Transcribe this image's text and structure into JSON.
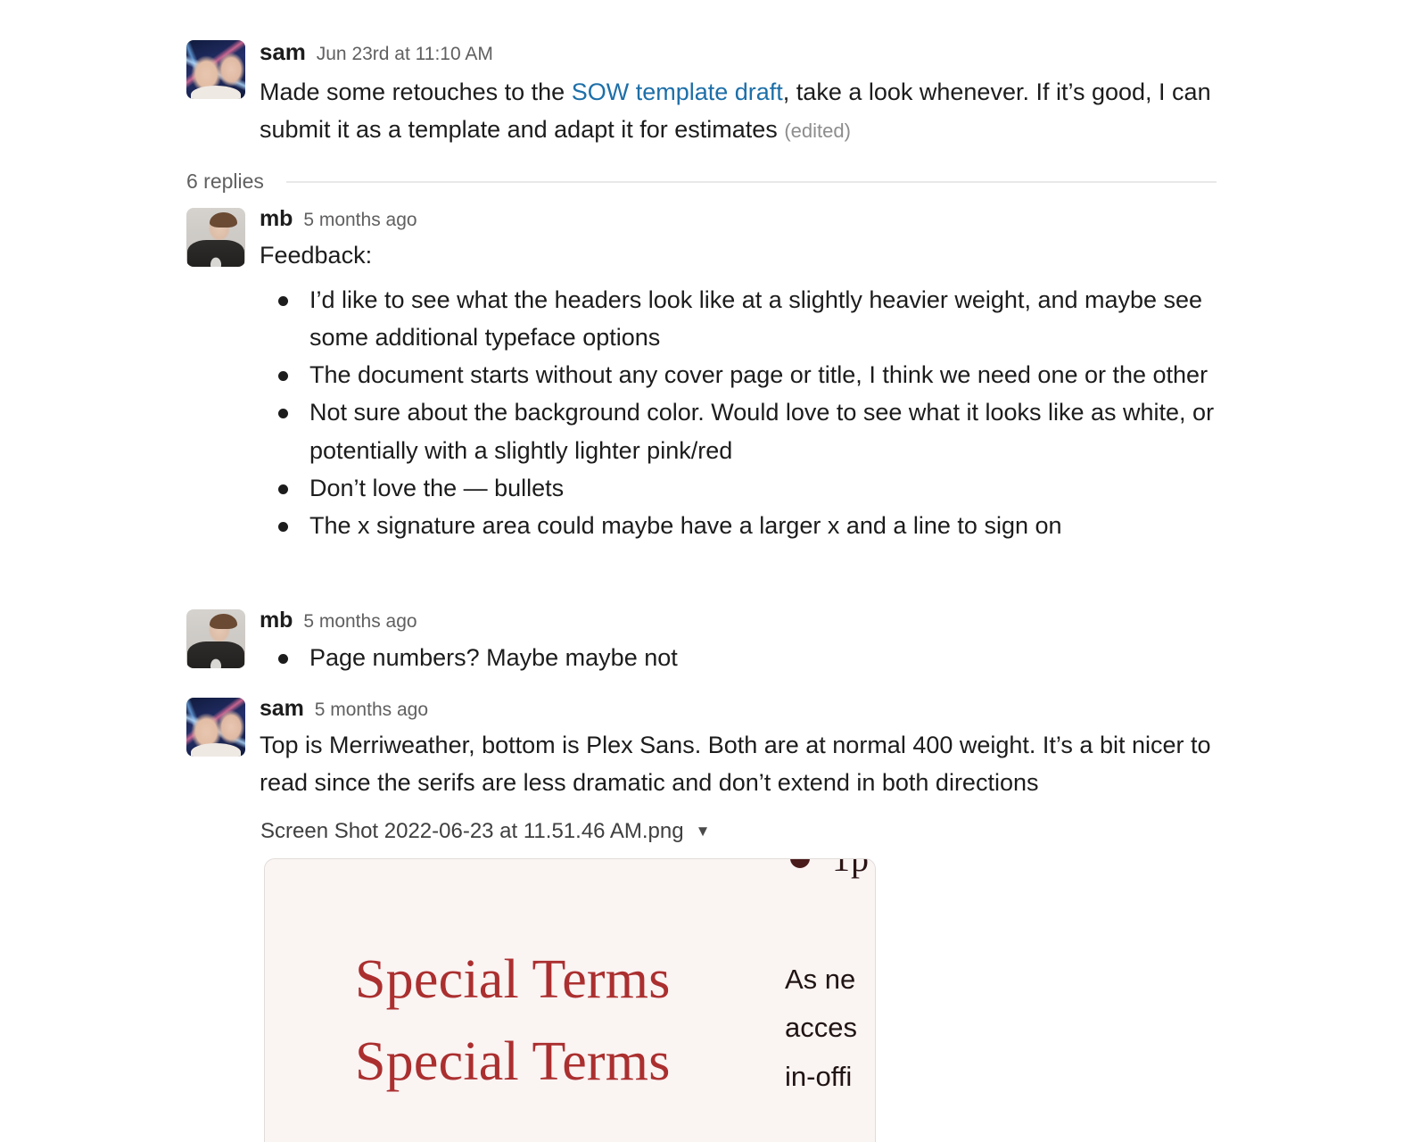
{
  "theme": {
    "background": "#ffffff",
    "text": "#1d1c1d",
    "muted": "#616061",
    "link": "#1d6fa8",
    "divider": "#e8e8e8",
    "preview_background": "#faf4f3",
    "preview_heading": "#ab2f2f"
  },
  "root_message": {
    "author": "sam",
    "timestamp": "Jun 23rd at 11:10 AM",
    "text_before_link": "Made some retouches to the ",
    "link_text": "SOW template draft",
    "text_after_link": ", take a look whenever. If it’s good, I can submit it as a template and adapt it for estimates",
    "edited_label": "(edited)"
  },
  "thread": {
    "replies_label": "6 replies"
  },
  "replies": [
    {
      "author": "mb",
      "timestamp": "5 months ago",
      "text": "Feedback:",
      "bullets": [
        "I’d like to see what the headers look like at a slightly heavier weight, and maybe see some additional typeface options",
        "The document starts without any cover page or title, I think we need one or the other",
        "Not sure about the background color. Would love to see what it looks like as white, or potentially with a slightly lighter pink/red",
        "Don’t love the — bullets",
        "The x signature area could maybe have a larger x and a line to sign on"
      ]
    },
    {
      "author": "mb",
      "timestamp": "5 months ago",
      "bullets": [
        "Page numbers? Maybe maybe not"
      ]
    },
    {
      "author": "sam",
      "timestamp": "5 months ago",
      "text": "Top is Merriweather, bottom is Plex Sans. Both are at normal 400 weight. It’s a bit nicer to read since the serifs are less dramatic and don’t extend in both directions"
    }
  ],
  "attachment": {
    "filename": "Screen Shot 2022-06-23 at 11.51.46 AM.png",
    "caret_icon": "▼",
    "preview": {
      "cut_top_text": "1p",
      "heading_serif": "Special Terms",
      "heading_sans": "Special Terms",
      "body_lines": [
        "As ne",
        "acces",
        "in-offi"
      ]
    }
  }
}
